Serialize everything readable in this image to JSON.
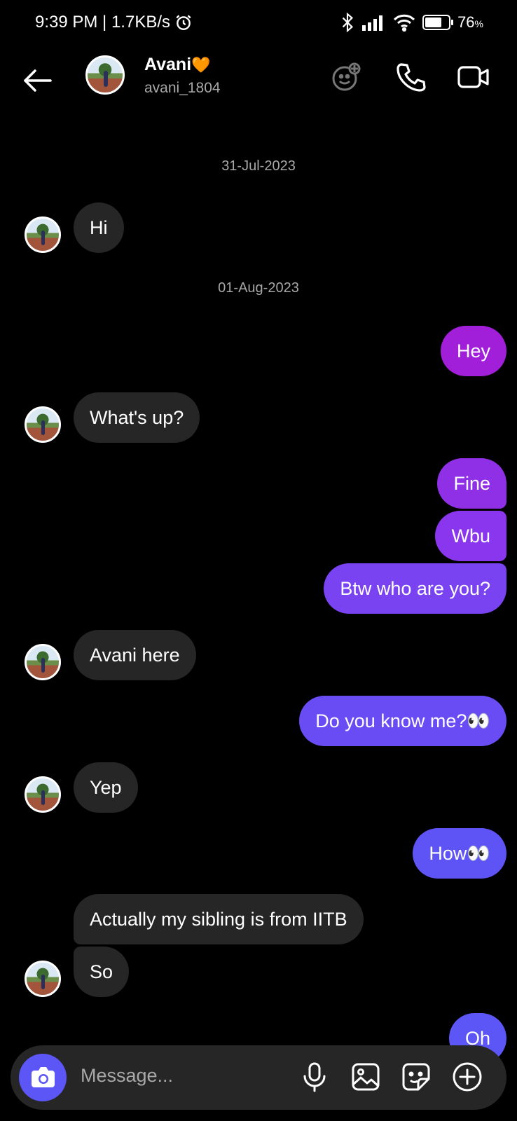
{
  "status_bar": {
    "time_speed": "9:39 PM | 1.7KB/s",
    "battery": "76",
    "battery_unit": "%",
    "battery_level": 0.76,
    "icons": [
      "alarm-icon",
      "bluetooth-icon",
      "signal-icon",
      "wifi-icon",
      "battery-icon"
    ]
  },
  "header": {
    "name": "Avani",
    "heart": "🧡",
    "username": "avani_1804",
    "icons": [
      "back-arrow-icon",
      "effects-icon",
      "phone-icon",
      "video-icon"
    ]
  },
  "dates": [
    "31-Jul-2023",
    "01-Aug-2023"
  ],
  "messages": [
    {
      "from": "them",
      "text": "Hi"
    },
    {
      "from": "me",
      "text": "Hey"
    },
    {
      "from": "them",
      "text": "What's up?"
    },
    {
      "from": "me",
      "text": "Fine"
    },
    {
      "from": "me",
      "text": "Wbu"
    },
    {
      "from": "me",
      "text": "Btw who are you?"
    },
    {
      "from": "them",
      "text": "Avani here"
    },
    {
      "from": "me",
      "text": "Do you know me?👀"
    },
    {
      "from": "them",
      "text": "Yep"
    },
    {
      "from": "me",
      "text": "How👀"
    },
    {
      "from": "them",
      "text": "Actually my sibling is from IITB"
    },
    {
      "from": "them",
      "text": "So"
    },
    {
      "from": "me",
      "text": "Oh"
    }
  ],
  "composer": {
    "placeholder": "Message...",
    "icons": [
      "camera-icon",
      "microphone-icon",
      "gallery-icon",
      "sticker-icon",
      "add-icon"
    ]
  },
  "colors": {
    "background": "#000000",
    "incoming_bubble": "#262626",
    "outgoing_gradient": [
      "#a21fd9",
      "#8a3cf0",
      "#6a4cf5",
      "#5b56f5"
    ],
    "camera_button": "#5b56f5"
  }
}
